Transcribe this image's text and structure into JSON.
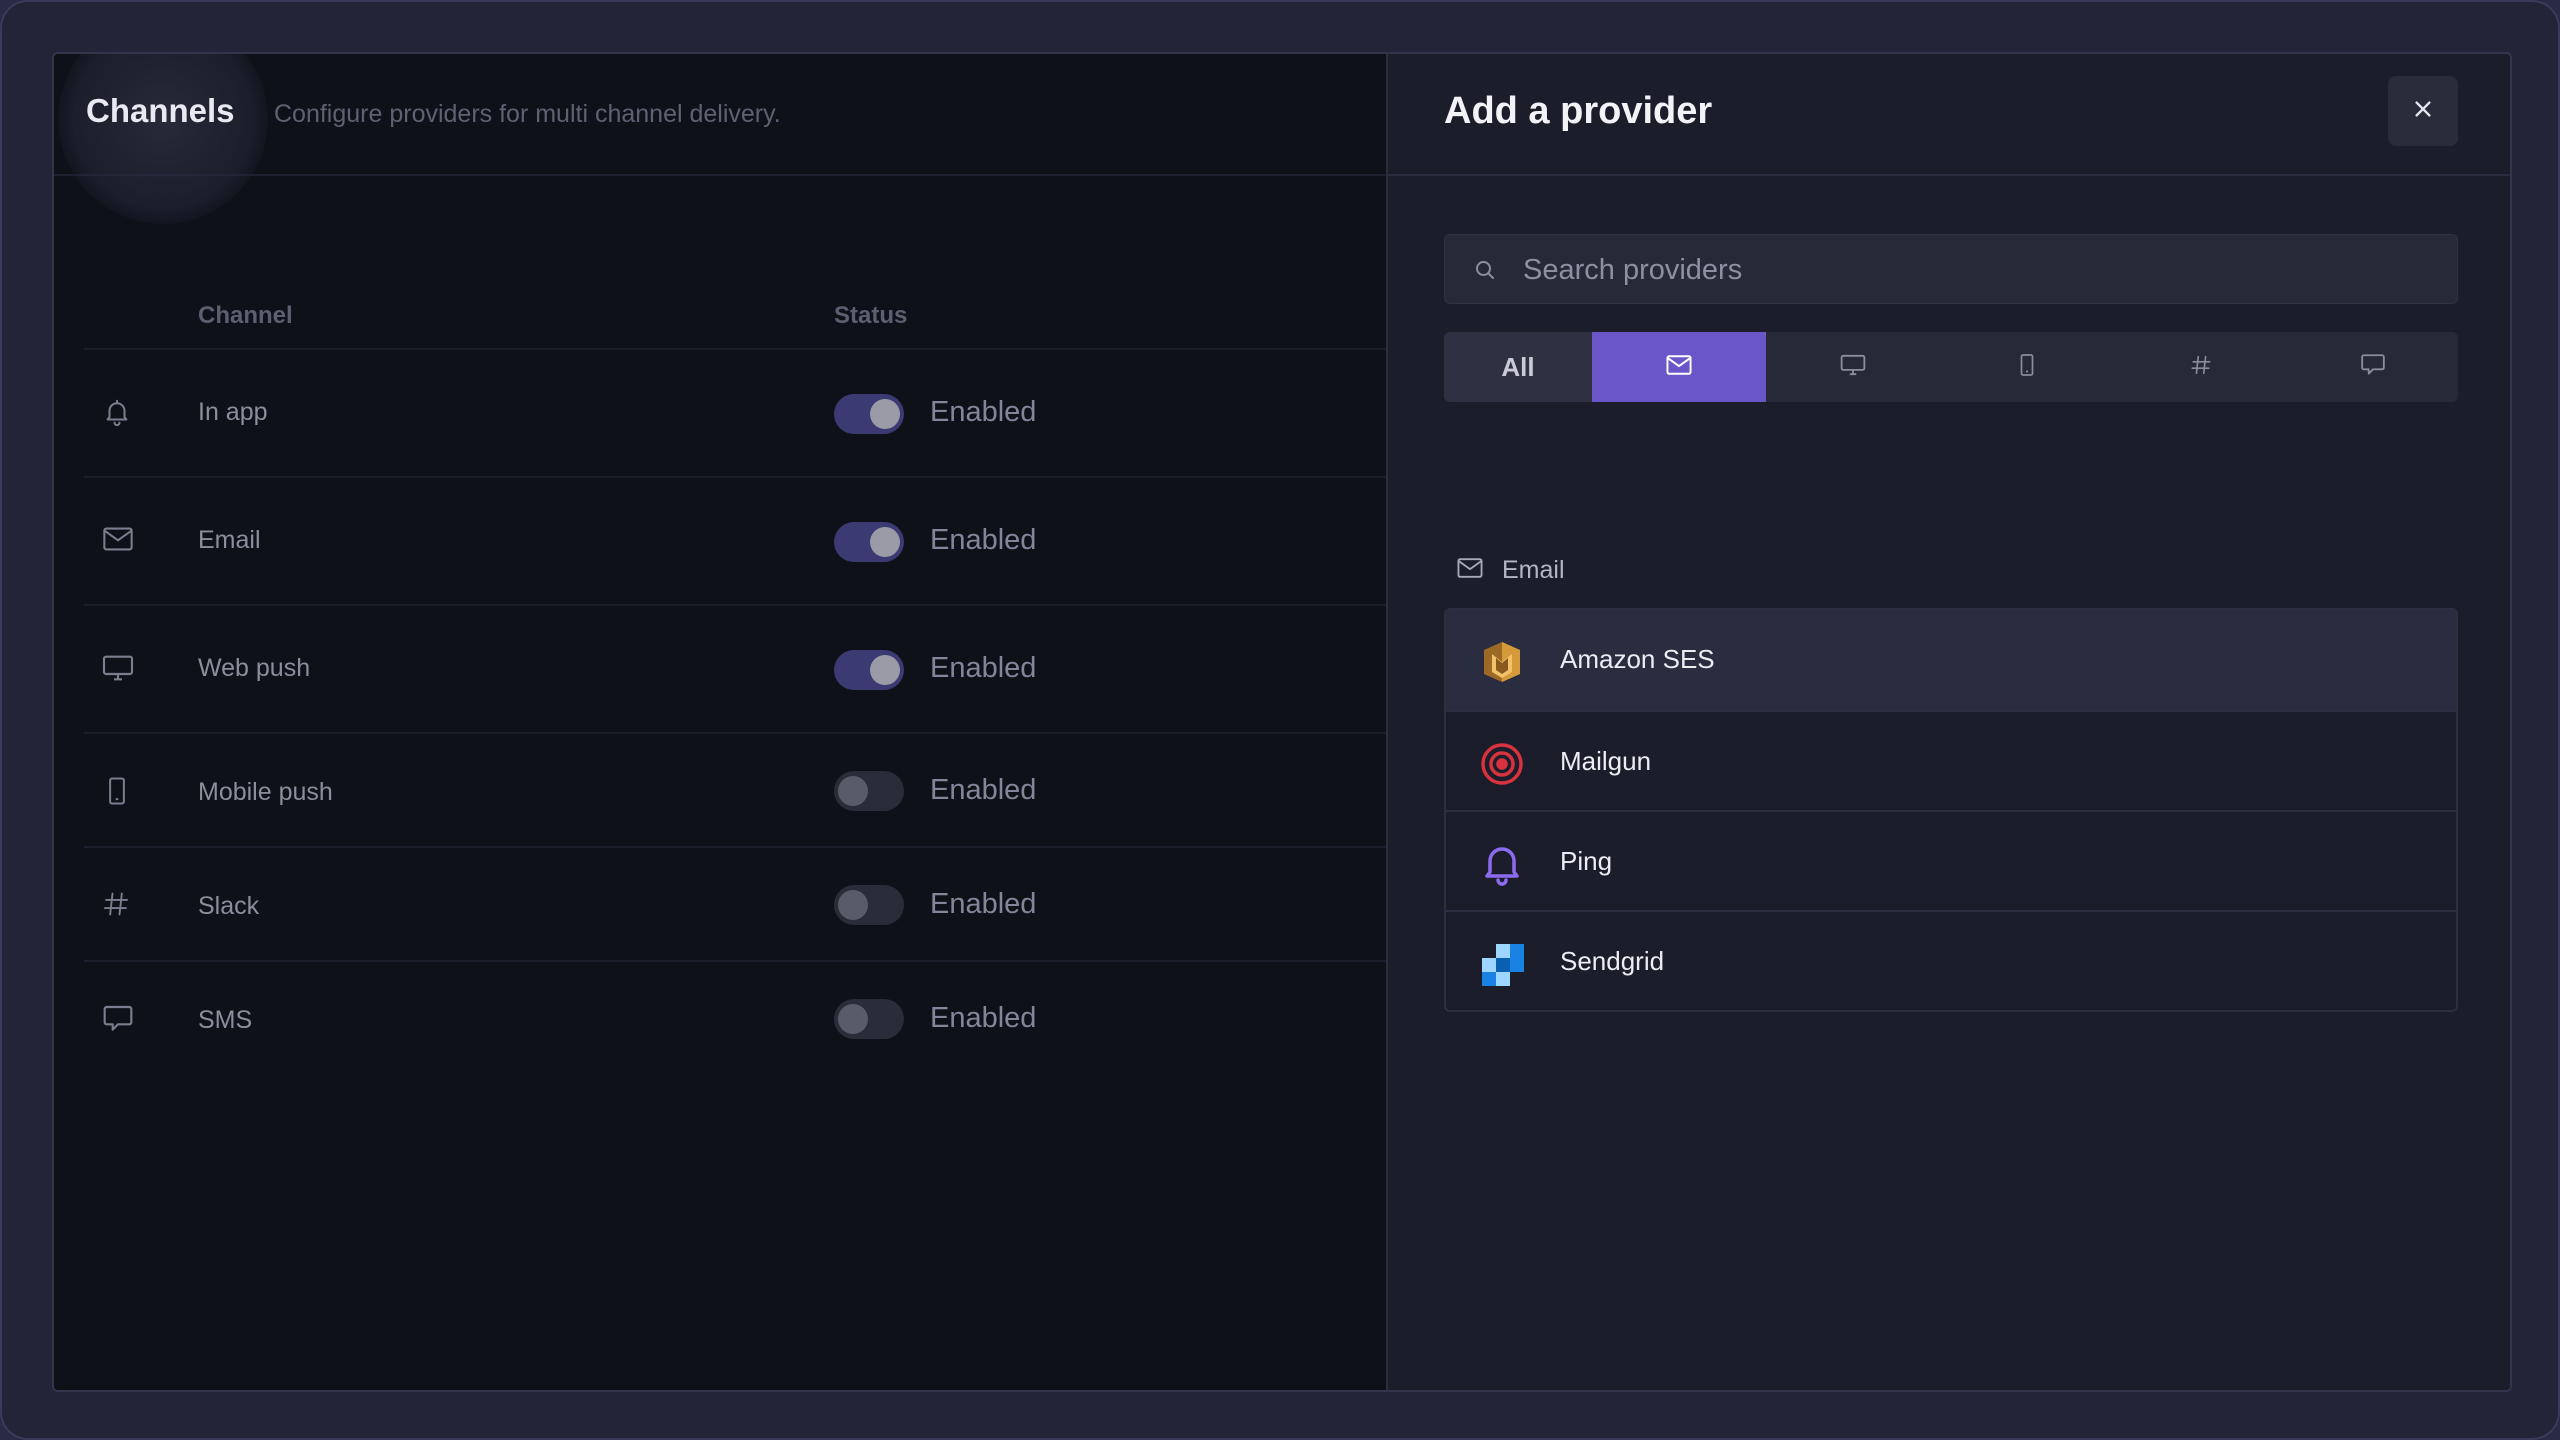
{
  "channels": {
    "title": "Channels",
    "subtitle": "Configure providers for multi channel delivery.",
    "columns": {
      "channel": "Channel",
      "status": "Status"
    },
    "rows": [
      {
        "icon": "bell-icon",
        "label": "In app",
        "status": "Enabled",
        "enabled": true
      },
      {
        "icon": "mail-icon",
        "label": "Email",
        "status": "Enabled",
        "enabled": true
      },
      {
        "icon": "monitor-icon",
        "label": "Web push",
        "status": "Enabled",
        "enabled": true
      },
      {
        "icon": "smartphone-icon",
        "label": "Mobile push",
        "status": "Enabled",
        "enabled": false
      },
      {
        "icon": "hash-icon",
        "label": "Slack",
        "status": "Enabled",
        "enabled": false
      },
      {
        "icon": "message-icon",
        "label": "SMS",
        "status": "Enabled",
        "enabled": false
      }
    ]
  },
  "panel": {
    "title": "Add a provider",
    "close_icon": "close-icon",
    "search": {
      "placeholder": "Search providers",
      "value": ""
    },
    "tabs": [
      {
        "label": "All",
        "icon": "",
        "active": false
      },
      {
        "label": "",
        "icon": "mail-icon",
        "active": true
      },
      {
        "label": "",
        "icon": "monitor-icon",
        "active": false
      },
      {
        "label": "",
        "icon": "smartphone-icon",
        "active": false
      },
      {
        "label": "",
        "icon": "hash-icon",
        "active": false
      },
      {
        "label": "",
        "icon": "message-icon",
        "active": false
      }
    ],
    "group": {
      "icon": "mail-icon",
      "label": "Email"
    },
    "providers": [
      {
        "name": "Amazon SES",
        "logo": "amazon-ses-logo",
        "highlighted": true
      },
      {
        "name": "Mailgun",
        "logo": "mailgun-logo",
        "highlighted": false
      },
      {
        "name": "Ping",
        "logo": "ping-logo",
        "highlighted": false
      },
      {
        "name": "Sendgrid",
        "logo": "sendgrid-logo",
        "highlighted": false
      }
    ]
  },
  "colors": {
    "accent": "#6a56c9",
    "toggle_on": "#3b3a72",
    "panel_bg": "#1c1d2b",
    "page_bg": "#0f1119"
  }
}
